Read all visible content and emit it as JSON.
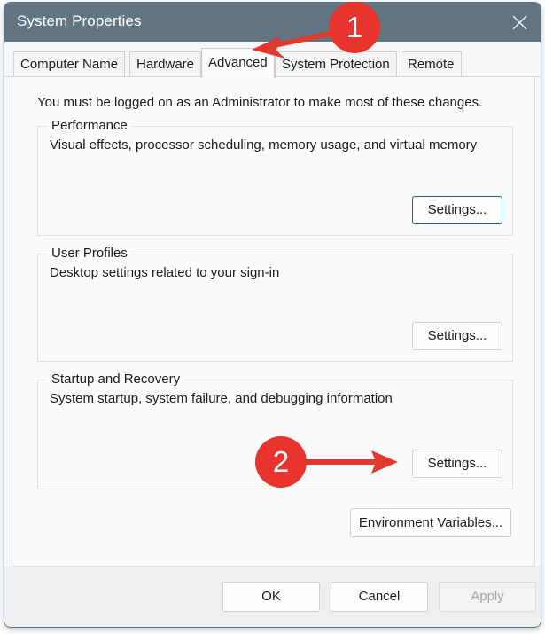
{
  "window": {
    "title": "System Properties",
    "close_icon": "close-icon",
    "titlebar_color": "#617582",
    "body_color": "#fafafa"
  },
  "tabs": [
    {
      "label": "Computer Name",
      "active": false
    },
    {
      "label": "Hardware",
      "active": false
    },
    {
      "label": "Advanced",
      "active": true
    },
    {
      "label": "System Protection",
      "active": false
    },
    {
      "label": "Remote",
      "active": false
    }
  ],
  "main": {
    "notice": "You must be logged on as an Administrator to make most of these changes.",
    "groups": [
      {
        "title": "Performance",
        "description": "Visual effects, processor scheduling, memory usage, and virtual memory",
        "button": "Settings...",
        "button_focused": true
      },
      {
        "title": "User Profiles",
        "description": "Desktop settings related to your sign-in",
        "button": "Settings...",
        "button_focused": false
      },
      {
        "title": "Startup and Recovery",
        "description": "System startup, system failure, and debugging information",
        "button": "Settings...",
        "button_focused": false
      }
    ],
    "environment_variables_button": "Environment Variables..."
  },
  "footer": {
    "ok": "OK",
    "cancel": "Cancel",
    "apply": "Apply",
    "apply_disabled": true
  },
  "annotations": {
    "accent_color": "#e8342c",
    "steps": [
      {
        "number": "1",
        "points_to": "Advanced tab"
      },
      {
        "number": "2",
        "points_to": "Startup and Recovery Settings button"
      }
    ]
  }
}
